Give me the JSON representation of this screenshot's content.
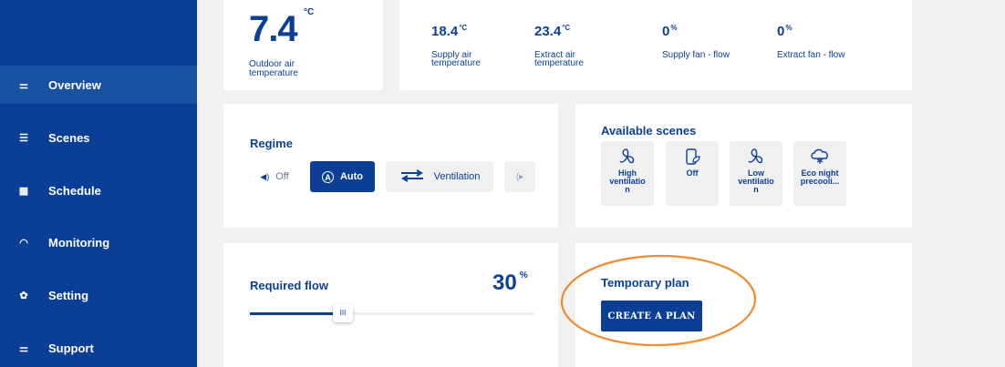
{
  "sidebar": {
    "items": [
      {
        "label": "Overview",
        "icon": "sliders-icon",
        "active": true
      },
      {
        "label": "Scenes",
        "icon": "list-icon"
      },
      {
        "label": "Schedule",
        "icon": "calendar-icon"
      },
      {
        "label": "Monitoring",
        "icon": "gauge-icon"
      },
      {
        "label": "Setting",
        "icon": "gear-icon"
      },
      {
        "label": "Support",
        "icon": "sliders-icon"
      }
    ]
  },
  "outdoor": {
    "value": "7.4",
    "unit": "°C",
    "label_line1": "Outdoor air",
    "label_line2": "temperature"
  },
  "metrics": [
    {
      "value": "18.4",
      "unit": "°C",
      "label_line1": "Supply air",
      "label_line2": "temperature"
    },
    {
      "value": "23.4",
      "unit": "°C",
      "label_line1": "Extract air",
      "label_line2": "temperature"
    },
    {
      "value": "0",
      "unit": "%",
      "label_line1": "Supply fan - flow",
      "label_line2": ""
    },
    {
      "value": "0",
      "unit": "%",
      "label_line1": "Extract fan - flow",
      "label_line2": ""
    }
  ],
  "regime": {
    "title": "Regime",
    "options": [
      {
        "label": "Off",
        "icon": "speaker-off-icon"
      },
      {
        "label": "Auto",
        "icon": "auto-circle-icon",
        "selected": true
      },
      {
        "label": "Ventilation",
        "icon": "exchange-arrows-icon"
      }
    ]
  },
  "scenes": {
    "title": "Available scenes",
    "items": [
      {
        "label_lines": [
          "High",
          "ventilatio",
          "n"
        ],
        "icon": "fan-icon"
      },
      {
        "label_lines": [
          "Off"
        ],
        "icon": "phone-leaf-icon"
      },
      {
        "label_lines": [
          "Low",
          "ventilatio",
          "n"
        ],
        "icon": "fan-icon"
      },
      {
        "label_lines": [
          "Eco night",
          "precooli..."
        ],
        "icon": "snow-cloud-icon"
      }
    ]
  },
  "flow": {
    "title": "Required flow",
    "value": "30",
    "unit": "%",
    "fraction": 0.3
  },
  "plan": {
    "title": "Temporary plan",
    "button": "CREATE A PLAN"
  },
  "colors": {
    "brand": "#0b3f96",
    "annotation": "#f28a2e"
  }
}
